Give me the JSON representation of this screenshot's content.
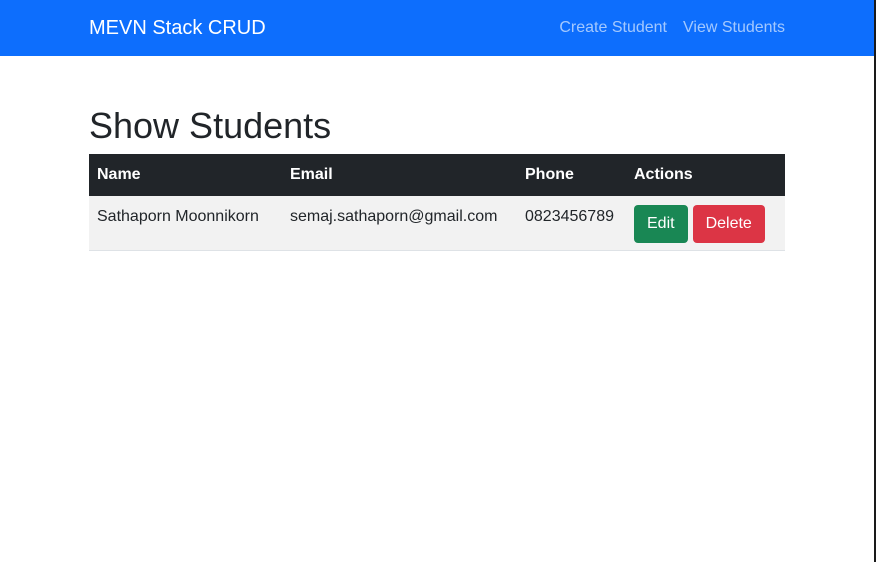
{
  "navbar": {
    "brand": "MEVN Stack CRUD",
    "links": [
      "Create Student",
      "View Students"
    ],
    "background": "#0d6efd"
  },
  "page": {
    "title": "Show Students"
  },
  "table": {
    "headers": [
      "Name",
      "Email",
      "Phone",
      "Actions"
    ],
    "rows": [
      {
        "name": "Sathaporn Moonnikorn",
        "email": "semaj.sathaporn@gmail.com",
        "phone": "0823456789",
        "edit_label": "Edit",
        "delete_label": "Delete"
      }
    ]
  },
  "colors": {
    "primary": "#0d6efd",
    "header_dark": "#212529",
    "edit_green": "#198754",
    "delete_red": "#dc3545"
  }
}
